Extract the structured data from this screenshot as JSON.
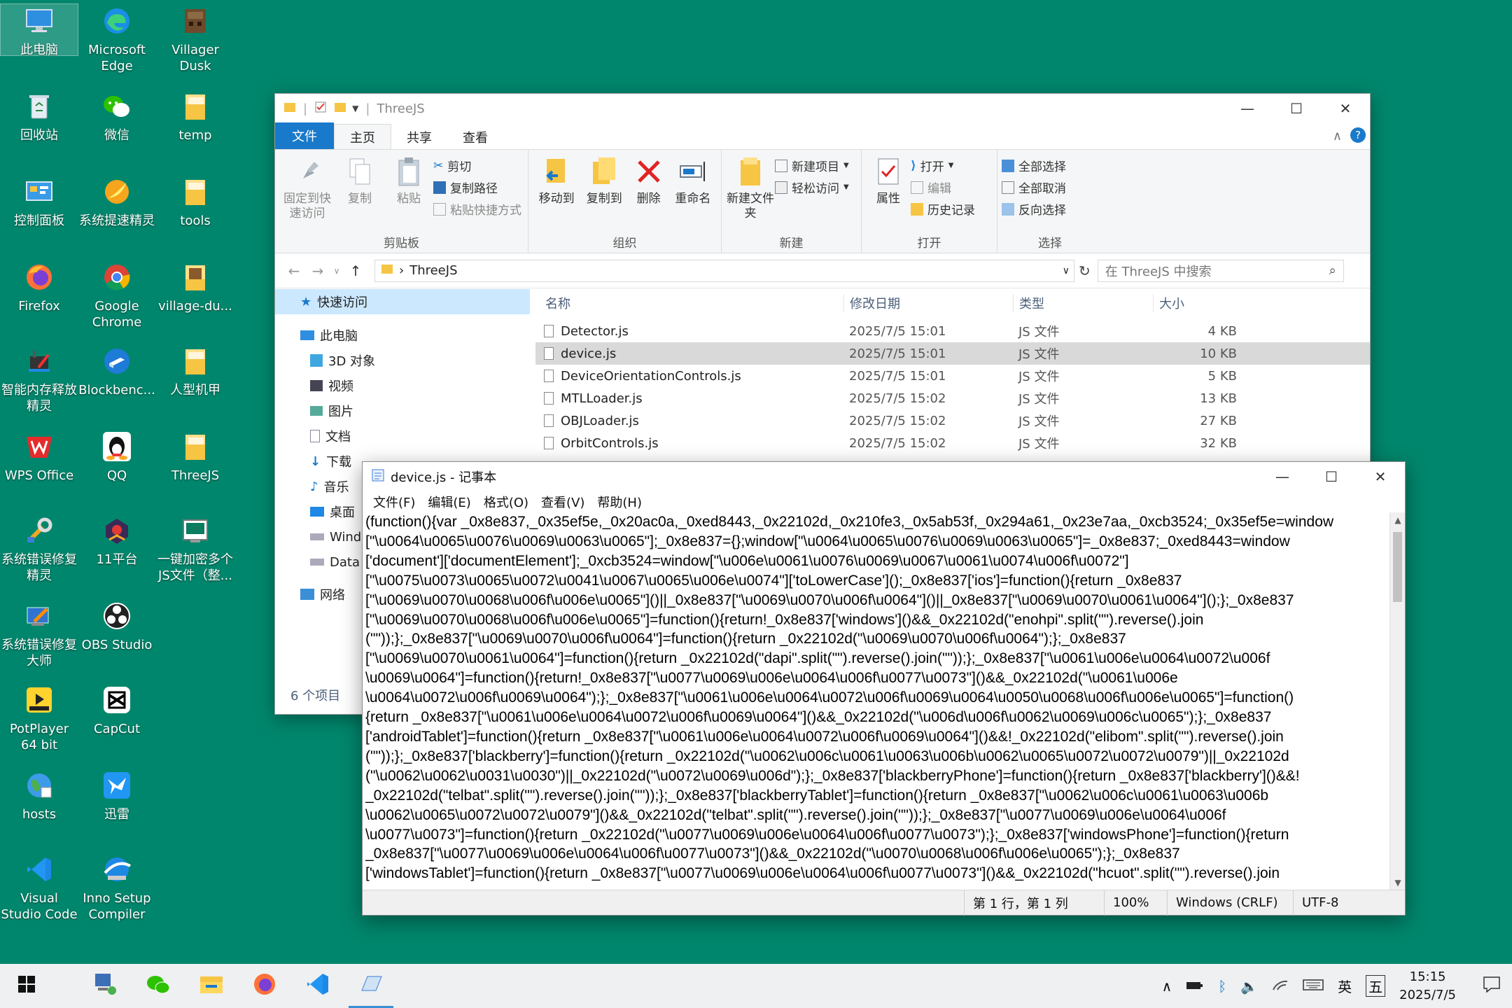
{
  "desktop": {
    "icons": [
      {
        "label": "此电脑"
      },
      {
        "label": "Microsoft Edge"
      },
      {
        "label": "Villager Dusk"
      },
      {
        "label": "回收站"
      },
      {
        "label": "微信"
      },
      {
        "label": "temp"
      },
      {
        "label": "控制面板"
      },
      {
        "label": "系统提速精灵"
      },
      {
        "label": "tools"
      },
      {
        "label": "Firefox"
      },
      {
        "label": "Google Chrome"
      },
      {
        "label": "village-du..."
      },
      {
        "label": "智能内存释放精灵"
      },
      {
        "label": "Blockbenc..."
      },
      {
        "label": "人型机甲"
      },
      {
        "label": "WPS Office"
      },
      {
        "label": "QQ"
      },
      {
        "label": "ThreeJS"
      },
      {
        "label": "系统错误修复精灵"
      },
      {
        "label": "11平台"
      },
      {
        "label": "一键加密多个JS文件（整..."
      },
      {
        "label": "系统错误修复大师"
      },
      {
        "label": "OBS Studio"
      },
      {
        "label": "PotPlayer 64 bit"
      },
      {
        "label": "CapCut"
      },
      {
        "label": "hosts"
      },
      {
        "label": "迅雷"
      },
      {
        "label": "Visual Studio Code"
      },
      {
        "label": "Inno Setup Compiler"
      }
    ]
  },
  "explorer": {
    "title": "ThreeJS",
    "tabs": {
      "file": "文件",
      "home": "主页",
      "share": "共享",
      "view": "查看"
    },
    "ribbon": {
      "pin": "固定到快速访问",
      "copy": "复制",
      "paste": "粘贴",
      "cut": "剪切",
      "copy_path": "复制路径",
      "paste_shortcut": "粘贴快捷方式",
      "group_clipboard": "剪贴板",
      "move_to": "移动到",
      "copy_to": "复制到",
      "delete": "删除",
      "rename": "重命名",
      "group_organize": "组织",
      "new_folder": "新建文件夹",
      "new_item": "新建项目",
      "easy_access": "轻松访问",
      "group_new": "新建",
      "properties": "属性",
      "open": "打开",
      "edit": "编辑",
      "history": "历史记录",
      "group_open": "打开",
      "select_all": "全部选择",
      "select_none": "全部取消",
      "invert_selection": "反向选择",
      "group_select": "选择"
    },
    "address": {
      "path": "ThreeJS",
      "search_placeholder": "在 ThreeJS 中搜索"
    },
    "nav": {
      "quick_access": "快速访问",
      "this_pc": "此电脑",
      "items": [
        "3D 对象",
        "视频",
        "图片",
        "文档",
        "下载",
        "音乐",
        "桌面",
        "Wind",
        "Data"
      ],
      "network": "网络"
    },
    "columns": {
      "name": "名称",
      "date": "修改日期",
      "type": "类型",
      "size": "大小"
    },
    "files": [
      {
        "name": "Detector.js",
        "date": "2025/7/5 15:01",
        "type": "JS 文件",
        "size": "4 KB"
      },
      {
        "name": "device.js",
        "date": "2025/7/5 15:01",
        "type": "JS 文件",
        "size": "10 KB"
      },
      {
        "name": "DeviceOrientationControls.js",
        "date": "2025/7/5 15:01",
        "type": "JS 文件",
        "size": "5 KB"
      },
      {
        "name": "MTLLoader.js",
        "date": "2025/7/5 15:02",
        "type": "JS 文件",
        "size": "13 KB"
      },
      {
        "name": "OBJLoader.js",
        "date": "2025/7/5 15:02",
        "type": "JS 文件",
        "size": "27 KB"
      },
      {
        "name": "OrbitControls.js",
        "date": "2025/7/5 15:02",
        "type": "JS 文件",
        "size": "32 KB"
      }
    ],
    "status": "6 个项目"
  },
  "notepad": {
    "title": "device.js - 记事本",
    "menu": {
      "file": "文件(F)",
      "edit": "编辑(E)",
      "format": "格式(O)",
      "view": "查看(V)",
      "help": "帮助(H)"
    },
    "lines": [
      "(function(){var _0x8e837,_0x35ef5e,_0x20ac0a,_0xed8443,_0x22102d,_0x210fe3,_0x5ab53f,_0x294a61,_0x23e7aa,_0xcb3524;_0x35ef5e=window",
      "[\"\\u0064\\u0065\\u0076\\u0069\\u0063\\u0065\"];_0x8e837={};window[\"\\u0064\\u0065\\u0076\\u0069\\u0063\\u0065\"]=_0x8e837;_0xed8443=window",
      "['document']['documentElement'];_0xcb3524=window[\"\\u006e\\u0061\\u0076\\u0069\\u0067\\u0061\\u0074\\u006f\\u0072\"]",
      "[\"\\u0075\\u0073\\u0065\\u0072\\u0041\\u0067\\u0065\\u006e\\u0074\"]['toLowerCase']();_0x8e837['ios']=function(){return _0x8e837",
      "[\"\\u0069\\u0070\\u0068\\u006f\\u006e\\u0065\"]()||_0x8e837[\"\\u0069\\u0070\\u006f\\u0064\"]()||_0x8e837[\"\\u0069\\u0070\\u0061\\u0064\"]();};_0x8e837",
      "[\"\\u0069\\u0070\\u0068\\u006f\\u006e\\u0065\"]=function(){return!_0x8e837['windows']()&&_0x22102d(\"enohpi\".split(\"\").reverse().join",
      "(\"\"));};_0x8e837[\"\\u0069\\u0070\\u006f\\u0064\"]=function(){return _0x22102d(\"\\u0069\\u0070\\u006f\\u0064\");};_0x8e837",
      "[\"\\u0069\\u0070\\u0061\\u0064\"]=function(){return _0x22102d(\"dapi\".split(\"\").reverse().join(\"\"));};_0x8e837[\"\\u0061\\u006e\\u0064\\u0072\\u006f",
      "\\u0069\\u0064\"]=function(){return!_0x8e837[\"\\u0077\\u0069\\u006e\\u0064\\u006f\\u0077\\u0073\"]()&&_0x22102d(\"\\u0061\\u006e",
      "\\u0064\\u0072\\u006f\\u0069\\u0064\");};_0x8e837[\"\\u0061\\u006e\\u0064\\u0072\\u006f\\u0069\\u0064\\u0050\\u0068\\u006f\\u006e\\u0065\"]=function()",
      "{return _0x8e837[\"\\u0061\\u006e\\u0064\\u0072\\u006f\\u0069\\u0064\"]()&&_0x22102d(\"\\u006d\\u006f\\u0062\\u0069\\u006c\\u0065\");};_0x8e837",
      "['androidTablet']=function(){return _0x8e837[\"\\u0061\\u006e\\u0064\\u0072\\u006f\\u0069\\u0064\"]()&&!_0x22102d(\"elibom\".split(\"\").reverse().join",
      "(\"\"));};_0x8e837['blackberry']=function(){return _0x22102d(\"\\u0062\\u006c\\u0061\\u0063\\u006b\\u0062\\u0065\\u0072\\u0072\\u0079\")||_0x22102d",
      "(\"\\u0062\\u0062\\u0031\\u0030\")||_0x22102d(\"\\u0072\\u0069\\u006d\");};_0x8e837['blackberryPhone']=function(){return _0x8e837['blackberry']()&&!",
      "_0x22102d(\"telbat\".split(\"\").reverse().join(\"\"));};_0x8e837['blackberryTablet']=function(){return _0x8e837[\"\\u0062\\u006c\\u0061\\u0063\\u006b",
      "\\u0062\\u0065\\u0072\\u0072\\u0079\"]()&&_0x22102d(\"telbat\".split(\"\").reverse().join(\"\"));};_0x8e837[\"\\u0077\\u0069\\u006e\\u0064\\u006f",
      "\\u0077\\u0073\"]=function(){return _0x22102d(\"\\u0077\\u0069\\u006e\\u0064\\u006f\\u0077\\u0073\");};_0x8e837['windowsPhone']=function(){return",
      "_0x8e837[\"\\u0077\\u0069\\u006e\\u0064\\u006f\\u0077\\u0073\"]()&&_0x22102d(\"\\u0070\\u0068\\u006f\\u006e\\u0065\");};_0x8e837",
      "['windowsTablet']=function(){return _0x8e837[\"\\u0077\\u0069\\u006e\\u0064\\u006f\\u0077\\u0073\"]()&&_0x22102d(\"hcuot\".split(\"\").reverse().join"
    ],
    "status": {
      "position": "第 1 行，第 1 列",
      "zoom": "100%",
      "eol": "Windows (CRLF)",
      "encoding": "UTF-8"
    }
  },
  "taskbar": {
    "ime": "英",
    "ime2": "五",
    "time": "15:15",
    "date": "2025/7/5"
  },
  "colors": {
    "desktop": "#00866c",
    "accent": "#1979ca"
  }
}
